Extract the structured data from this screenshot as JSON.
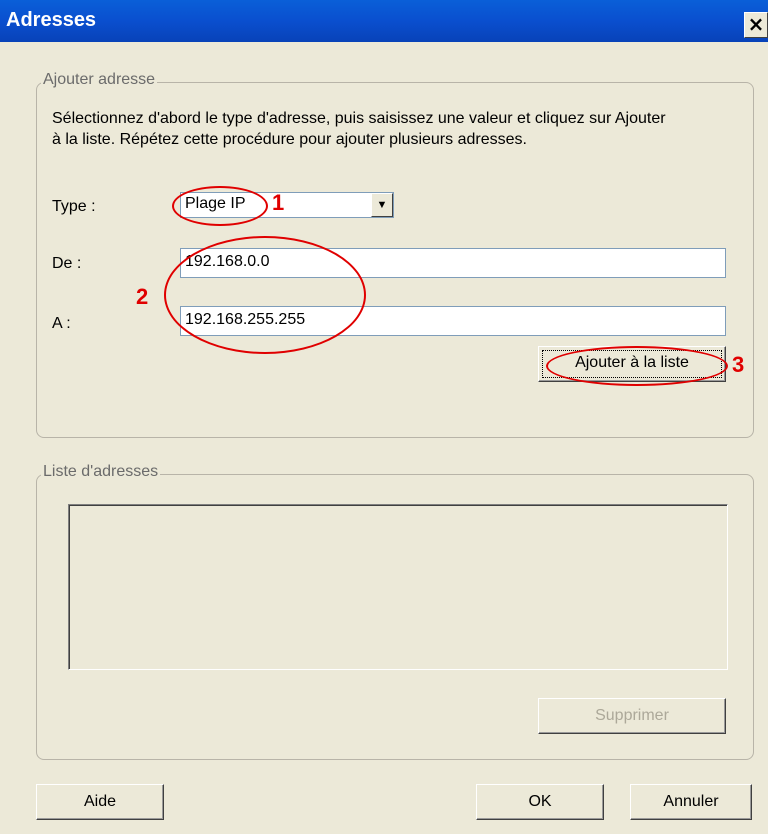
{
  "window": {
    "title": "Adresses",
    "close_glyph": "×"
  },
  "add_group": {
    "legend": "Ajouter adresse",
    "description": "Sélectionnez d'abord le type d'adresse, puis saisissez une valeur et cliquez sur Ajouter à la liste. Répétez cette procédure pour ajouter plusieurs adresses.",
    "type_label": "Type :",
    "type_value": "Plage IP",
    "from_label": "De :",
    "from_value": "192.168.0.0",
    "to_label": "A :",
    "to_value": "192.168.255.255",
    "add_button": "Ajouter à la liste"
  },
  "list_group": {
    "legend": "Liste d'adresses",
    "items": [],
    "delete_button": "Supprimer"
  },
  "footer": {
    "help_button": "Aide",
    "ok_button": "OK",
    "cancel_button": "Annuler"
  },
  "annotations": {
    "step1": "1",
    "step2": "2",
    "step3": "3",
    "color": "#e00000"
  },
  "icons": {
    "dropdown": "chevron-down-icon",
    "close": "close-icon"
  }
}
